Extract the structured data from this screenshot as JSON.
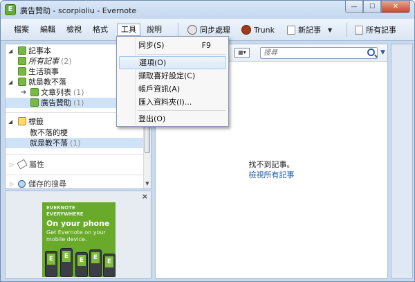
{
  "window": {
    "title": "廣告贊助 - scorpioliu - Evernote",
    "app_icon": "evernote-icon",
    "controls": [
      "minimize-icon",
      "maximize-icon",
      "close-icon"
    ]
  },
  "menu": [
    "檔案",
    "編輯",
    "檢視",
    "格式",
    "工具",
    "說明"
  ],
  "toolbar": {
    "sync_label": "同步處理",
    "trunk_label": "Trunk",
    "new_note_label": "新記事",
    "all_notes_label": "所有記事"
  },
  "tools_menu": {
    "items": [
      {
        "label": "同步(S)",
        "shortcut": "F9"
      },
      {
        "label": "選項(O)",
        "shortcut": ""
      },
      {
        "label": "擷取喜好設定(C)",
        "shortcut": ""
      },
      {
        "label": "帳戶資訊(A)",
        "shortcut": ""
      },
      {
        "label": "匯入資料夾(I)...",
        "shortcut": ""
      },
      {
        "label": "登出(O)",
        "shortcut": ""
      }
    ]
  },
  "sidebar": {
    "notebooks_header": "記事本",
    "all_notes": {
      "label": "所有記事",
      "count": "(2)"
    },
    "notebooks": [
      {
        "label": "生活瑣事",
        "count": ""
      },
      {
        "label": "就是教不落",
        "count": ""
      },
      {
        "label": "文章列表",
        "count": "(1)"
      },
      {
        "label": "廣告贊助",
        "count": "(1)"
      }
    ],
    "tags_header": "標籤",
    "tags": [
      {
        "label": "教不落的梗",
        "count": ""
      },
      {
        "label": "就是教不落",
        "count": "(1)"
      }
    ],
    "attributes_header": "屬性",
    "saved_searches_header": "儲存的搜尋"
  },
  "ad": {
    "close_label": "×",
    "brand_line1": "EVERNOTE",
    "brand_line2": "EVERYWHERE",
    "headline": "On your phone",
    "sub_line1": "Get Evernote on your",
    "sub_line2": "mobile device.",
    "phone_glyph": "E"
  },
  "notes_panel": {
    "search_placeholder": "搜尋",
    "empty_message": "找不到記事。",
    "view_all_link": "檢視所有記事"
  },
  "colors": {
    "accent": "#2a5e99",
    "selection": "#cfe3f8",
    "evernote_green": "#6aaa2a",
    "link": "#1a5bb0"
  }
}
